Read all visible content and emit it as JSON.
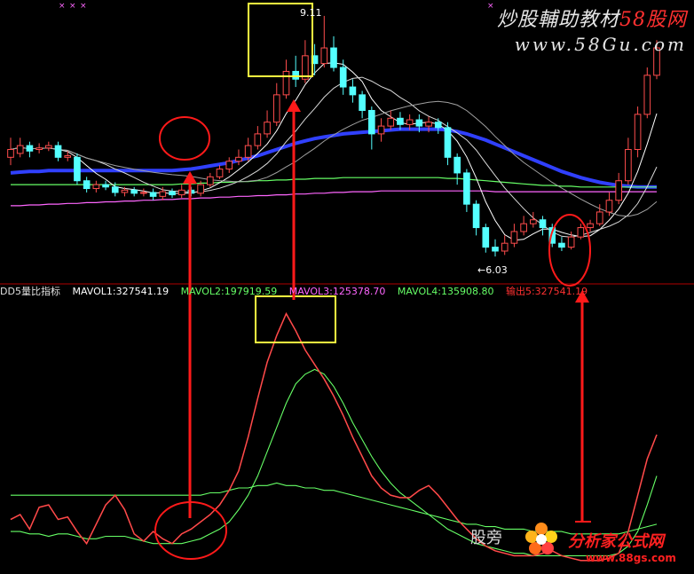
{
  "top_panel": {
    "high_label": "9.11",
    "low_label": "←6.03"
  },
  "indicator_legend": {
    "name": "DD5量比指标",
    "mavol1": "MAVOL1:327541.19",
    "mavol2": "MAVOL2:197919.59",
    "mavol3": "MAVOL3:125378.70",
    "mavol4": "MAVOL4:135908.80",
    "output": "输出5:327541.19"
  },
  "watermarks": {
    "top_title_a": "炒股輔助教材",
    "top_title_b": "58股网",
    "top_url": "www.58Gu.com",
    "bottom_cn": "股旁",
    "bottom_logo": "分析家公式网",
    "bottom_url": "www.88gs.com"
  },
  "colors": {
    "background": "#000000",
    "up_candle": "#ff4d4d",
    "down_candle": "#54ffff",
    "ma_thick": "#3040ff",
    "mavol1": "#ffffff",
    "mavol2": "#ff66ff",
    "mavol3": "#ff3030",
    "mavol4": "#66ff66",
    "output": "#ff3030",
    "annotation": "#ff1a1a",
    "highlight_box": "#ffff40"
  },
  "chart_data": [
    {
      "type": "candlestick",
      "price_annotations": {
        "high": 9.11,
        "low": 6.03
      },
      "candles": [
        {
          "o": 7.3,
          "c": 7.4,
          "h": 7.55,
          "l": 7.2
        },
        {
          "o": 7.35,
          "c": 7.45,
          "h": 7.55,
          "l": 7.3
        },
        {
          "o": 7.45,
          "c": 7.38,
          "h": 7.5,
          "l": 7.3
        },
        {
          "o": 7.4,
          "c": 7.42,
          "h": 7.48,
          "l": 7.35
        },
        {
          "o": 7.42,
          "c": 7.45,
          "h": 7.5,
          "l": 7.38
        },
        {
          "o": 7.45,
          "c": 7.3,
          "h": 7.5,
          "l": 7.25
        },
        {
          "o": 7.3,
          "c": 7.32,
          "h": 7.38,
          "l": 7.25
        },
        {
          "o": 7.3,
          "c": 7.0,
          "h": 7.35,
          "l": 6.95
        },
        {
          "o": 7.0,
          "c": 6.9,
          "h": 7.05,
          "l": 6.85
        },
        {
          "o": 6.9,
          "c": 6.95,
          "h": 7.0,
          "l": 6.85
        },
        {
          "o": 6.95,
          "c": 6.92,
          "h": 7.0,
          "l": 6.88
        },
        {
          "o": 6.92,
          "c": 6.85,
          "h": 6.98,
          "l": 6.8
        },
        {
          "o": 6.85,
          "c": 6.88,
          "h": 6.92,
          "l": 6.8
        },
        {
          "o": 6.88,
          "c": 6.84,
          "h": 6.92,
          "l": 6.8
        },
        {
          "o": 6.84,
          "c": 6.85,
          "h": 6.9,
          "l": 6.8
        },
        {
          "o": 6.85,
          "c": 6.8,
          "h": 6.9,
          "l": 6.75
        },
        {
          "o": 6.8,
          "c": 6.86,
          "h": 6.92,
          "l": 6.75
        },
        {
          "o": 6.86,
          "c": 6.82,
          "h": 6.9,
          "l": 6.78
        },
        {
          "o": 6.82,
          "c": 6.88,
          "h": 6.95,
          "l": 6.78
        },
        {
          "o": 6.88,
          "c": 6.84,
          "h": 6.92,
          "l": 6.8
        },
        {
          "o": 6.84,
          "c": 6.95,
          "h": 7.0,
          "l": 6.8
        },
        {
          "o": 6.95,
          "c": 7.05,
          "h": 7.1,
          "l": 6.92
        },
        {
          "o": 7.05,
          "c": 7.15,
          "h": 7.2,
          "l": 7.02
        },
        {
          "o": 7.15,
          "c": 7.25,
          "h": 7.3,
          "l": 7.1
        },
        {
          "o": 7.25,
          "c": 7.3,
          "h": 7.4,
          "l": 7.2
        },
        {
          "o": 7.3,
          "c": 7.45,
          "h": 7.55,
          "l": 7.25
        },
        {
          "o": 7.45,
          "c": 7.6,
          "h": 7.7,
          "l": 7.4
        },
        {
          "o": 7.6,
          "c": 7.75,
          "h": 7.9,
          "l": 7.55
        },
        {
          "o": 7.75,
          "c": 8.1,
          "h": 8.25,
          "l": 7.7
        },
        {
          "o": 8.1,
          "c": 8.4,
          "h": 8.55,
          "l": 8.05
        },
        {
          "o": 8.4,
          "c": 8.3,
          "h": 8.6,
          "l": 8.2
        },
        {
          "o": 8.3,
          "c": 8.6,
          "h": 8.8,
          "l": 8.25
        },
        {
          "o": 8.6,
          "c": 8.5,
          "h": 8.75,
          "l": 8.35
        },
        {
          "o": 8.5,
          "c": 8.7,
          "h": 9.11,
          "l": 8.45
        },
        {
          "o": 8.7,
          "c": 8.45,
          "h": 8.85,
          "l": 8.4
        },
        {
          "o": 8.45,
          "c": 8.2,
          "h": 8.55,
          "l": 8.1
        },
        {
          "o": 8.2,
          "c": 8.1,
          "h": 8.3,
          "l": 8.0
        },
        {
          "o": 8.1,
          "c": 7.9,
          "h": 8.15,
          "l": 7.8
        },
        {
          "o": 7.9,
          "c": 7.6,
          "h": 7.95,
          "l": 7.4
        },
        {
          "o": 7.6,
          "c": 7.7,
          "h": 7.8,
          "l": 7.5
        },
        {
          "o": 7.7,
          "c": 7.8,
          "h": 7.9,
          "l": 7.65
        },
        {
          "o": 7.8,
          "c": 7.72,
          "h": 7.88,
          "l": 7.65
        },
        {
          "o": 7.72,
          "c": 7.78,
          "h": 7.85,
          "l": 7.65
        },
        {
          "o": 7.78,
          "c": 7.7,
          "h": 7.85,
          "l": 7.62
        },
        {
          "o": 7.7,
          "c": 7.75,
          "h": 7.82,
          "l": 7.62
        },
        {
          "o": 7.75,
          "c": 7.68,
          "h": 7.8,
          "l": 7.6
        },
        {
          "o": 7.68,
          "c": 7.3,
          "h": 7.75,
          "l": 7.2
        },
        {
          "o": 7.3,
          "c": 7.1,
          "h": 7.35,
          "l": 6.95
        },
        {
          "o": 7.1,
          "c": 6.7,
          "h": 7.15,
          "l": 6.6
        },
        {
          "o": 6.7,
          "c": 6.4,
          "h": 6.75,
          "l": 6.3
        },
        {
          "o": 6.4,
          "c": 6.15,
          "h": 6.45,
          "l": 6.08
        },
        {
          "o": 6.15,
          "c": 6.1,
          "h": 6.25,
          "l": 6.03
        },
        {
          "o": 6.1,
          "c": 6.2,
          "h": 6.3,
          "l": 6.05
        },
        {
          "o": 6.2,
          "c": 6.35,
          "h": 6.45,
          "l": 6.15
        },
        {
          "o": 6.35,
          "c": 6.45,
          "h": 6.55,
          "l": 6.3
        },
        {
          "o": 6.45,
          "c": 6.5,
          "h": 6.6,
          "l": 6.4
        },
        {
          "o": 6.5,
          "c": 6.4,
          "h": 6.55,
          "l": 6.3
        },
        {
          "o": 6.4,
          "c": 6.2,
          "h": 6.45,
          "l": 6.15
        },
        {
          "o": 6.2,
          "c": 6.15,
          "h": 6.28,
          "l": 6.1
        },
        {
          "o": 6.15,
          "c": 6.28,
          "h": 6.35,
          "l": 6.12
        },
        {
          "o": 6.28,
          "c": 6.4,
          "h": 6.45,
          "l": 6.25
        },
        {
          "o": 6.4,
          "c": 6.45,
          "h": 6.5,
          "l": 6.35
        },
        {
          "o": 6.45,
          "c": 6.6,
          "h": 6.7,
          "l": 6.42
        },
        {
          "o": 6.6,
          "c": 6.75,
          "h": 6.85,
          "l": 6.55
        },
        {
          "o": 6.75,
          "c": 7.0,
          "h": 7.1,
          "l": 6.7
        },
        {
          "o": 7.0,
          "c": 7.4,
          "h": 7.55,
          "l": 6.95
        },
        {
          "o": 7.4,
          "c": 7.85,
          "h": 7.95,
          "l": 7.3
        },
        {
          "o": 7.85,
          "c": 8.35,
          "h": 8.45,
          "l": 7.8
        },
        {
          "o": 8.35,
          "c": 8.7,
          "h": 8.8,
          "l": 8.3
        }
      ],
      "moving_averages": [
        {
          "color": "#3040ff",
          "values": [
            7.1,
            7.11,
            7.12,
            7.12,
            7.13,
            7.13,
            7.13,
            7.13,
            7.13,
            7.13,
            7.13,
            7.13,
            7.13,
            7.13,
            7.13,
            7.13,
            7.13,
            7.13,
            7.14,
            7.15,
            7.17,
            7.19,
            7.21,
            7.23,
            7.26,
            7.29,
            7.32,
            7.36,
            7.4,
            7.44,
            7.48,
            7.51,
            7.54,
            7.56,
            7.58,
            7.6,
            7.61,
            7.62,
            7.63,
            7.64,
            7.65,
            7.66,
            7.66,
            7.66,
            7.66,
            7.66,
            7.65,
            7.63,
            7.6,
            7.56,
            7.52,
            7.47,
            7.42,
            7.37,
            7.32,
            7.27,
            7.22,
            7.17,
            7.12,
            7.08,
            7.04,
            7.01,
            6.98,
            6.96,
            6.94,
            6.93,
            6.92,
            6.92,
            6.92
          ]
        },
        {
          "color": "#66ff66",
          "values": [
            6.95,
            6.95,
            6.95,
            6.95,
            6.95,
            6.95,
            6.95,
            6.95,
            6.95,
            6.95,
            6.95,
            6.95,
            6.95,
            6.95,
            6.95,
            6.95,
            6.95,
            6.95,
            6.96,
            6.96,
            6.97,
            6.97,
            6.98,
            6.98,
            6.99,
            6.99,
            7.0,
            7.0,
            7.01,
            7.01,
            7.02,
            7.02,
            7.03,
            7.03,
            7.03,
            7.04,
            7.04,
            7.04,
            7.04,
            7.04,
            7.04,
            7.04,
            7.04,
            7.04,
            7.04,
            7.04,
            7.03,
            7.03,
            7.02,
            7.01,
            7.0,
            6.99,
            6.98,
            6.97,
            6.96,
            6.95,
            6.94,
            6.94,
            6.93,
            6.93,
            6.92,
            6.92,
            6.92,
            6.92,
            6.92,
            6.92,
            6.92,
            6.92,
            6.92
          ]
        },
        {
          "color": "#ff66ff",
          "values": [
            6.68,
            6.68,
            6.69,
            6.69,
            6.7,
            6.7,
            6.71,
            6.71,
            6.72,
            6.72,
            6.73,
            6.73,
            6.74,
            6.74,
            6.75,
            6.75,
            6.76,
            6.76,
            6.77,
            6.77,
            6.78,
            6.78,
            6.79,
            6.79,
            6.8,
            6.8,
            6.81,
            6.81,
            6.82,
            6.82,
            6.83,
            6.83,
            6.84,
            6.84,
            6.85,
            6.85,
            6.86,
            6.86,
            6.86,
            6.87,
            6.87,
            6.87,
            6.87,
            6.87,
            6.87,
            6.87,
            6.87,
            6.87,
            6.87,
            6.87,
            6.87,
            6.86,
            6.86,
            6.86,
            6.86,
            6.86,
            6.86,
            6.86,
            6.86,
            6.86,
            6.86,
            6.86,
            6.86,
            6.86,
            6.86,
            6.86,
            6.86,
            6.86,
            6.86
          ]
        }
      ]
    },
    {
      "type": "line",
      "series": [
        {
          "name": "MAVOL1",
          "color": "#ffffff",
          "values": [
            2.0,
            2.2,
            1.6,
            2.5,
            2.6,
            2.0,
            2.1,
            1.5,
            1.0,
            1.8,
            2.6,
            3.0,
            2.4,
            1.4,
            1.1,
            1.5,
            1.2,
            1.0,
            1.4,
            1.6,
            1.9,
            2.2,
            2.6,
            3.2,
            4.0,
            5.4,
            7.0,
            8.5,
            9.6,
            10.5,
            9.8,
            9.0,
            8.4,
            7.8,
            7.1,
            6.3,
            5.4,
            4.6,
            3.8,
            3.3,
            3.0,
            2.9,
            2.9,
            3.2,
            3.4,
            3.0,
            2.5,
            2.0,
            1.6,
            1.2,
            0.9,
            0.7,
            0.6,
            0.5,
            0.5,
            0.5,
            0.6,
            0.7,
            0.5,
            0.4,
            0.3,
            0.3,
            0.3,
            0.4,
            0.6,
            1.5,
            3.0,
            4.5,
            5.5
          ]
        },
        {
          "name": "MAVOL2",
          "color": "#66ff66",
          "values": [
            3.0,
            3.0,
            3.0,
            3.0,
            3.0,
            3.0,
            3.0,
            3.0,
            3.0,
            3.0,
            3.0,
            3.0,
            3.0,
            3.0,
            3.0,
            3.0,
            3.0,
            3.0,
            3.0,
            3.0,
            3.0,
            3.1,
            3.1,
            3.2,
            3.3,
            3.3,
            3.4,
            3.4,
            3.5,
            3.4,
            3.4,
            3.3,
            3.3,
            3.2,
            3.2,
            3.1,
            3.0,
            2.9,
            2.8,
            2.7,
            2.6,
            2.5,
            2.4,
            2.3,
            2.2,
            2.1,
            2.0,
            1.9,
            1.8,
            1.8,
            1.7,
            1.7,
            1.6,
            1.6,
            1.6,
            1.5,
            1.5,
            1.5,
            1.5,
            1.4,
            1.4,
            1.4,
            1.4,
            1.4,
            1.4,
            1.5,
            1.6,
            1.7,
            1.8
          ]
        },
        {
          "name": "MAVOL3",
          "color": "#66ff66",
          "values": [
            1.5,
            1.5,
            1.4,
            1.4,
            1.3,
            1.4,
            1.4,
            1.3,
            1.2,
            1.2,
            1.3,
            1.3,
            1.3,
            1.2,
            1.1,
            1.0,
            1.0,
            1.0,
            1.0,
            1.1,
            1.2,
            1.4,
            1.6,
            1.9,
            2.4,
            3.0,
            3.8,
            4.8,
            5.8,
            6.8,
            7.6,
            8.0,
            8.2,
            8.0,
            7.5,
            6.8,
            6.0,
            5.3,
            4.6,
            4.0,
            3.5,
            3.1,
            2.8,
            2.5,
            2.2,
            1.9,
            1.6,
            1.4,
            1.2,
            1.0,
            0.9,
            0.8,
            0.7,
            0.6,
            0.6,
            0.5,
            0.5,
            0.5,
            0.5,
            0.5,
            0.5,
            0.5,
            0.5,
            0.5,
            0.6,
            0.9,
            1.5,
            2.6,
            3.8
          ]
        },
        {
          "name": "输出5",
          "color": "#ff3030",
          "values": [
            2.0,
            2.2,
            1.6,
            2.5,
            2.6,
            2.0,
            2.1,
            1.5,
            1.0,
            1.8,
            2.6,
            3.0,
            2.4,
            1.4,
            1.1,
            1.5,
            1.2,
            1.0,
            1.4,
            1.6,
            1.9,
            2.2,
            2.6,
            3.2,
            4.0,
            5.4,
            7.0,
            8.5,
            9.6,
            10.5,
            9.8,
            9.0,
            8.4,
            7.8,
            7.1,
            6.3,
            5.4,
            4.6,
            3.8,
            3.3,
            3.0,
            2.9,
            2.9,
            3.2,
            3.4,
            3.0,
            2.5,
            2.0,
            1.6,
            1.2,
            0.9,
            0.7,
            0.6,
            0.5,
            0.5,
            0.5,
            0.6,
            0.7,
            0.5,
            0.4,
            0.3,
            0.3,
            0.3,
            0.4,
            0.6,
            1.5,
            3.0,
            4.5,
            5.5
          ]
        }
      ]
    }
  ]
}
